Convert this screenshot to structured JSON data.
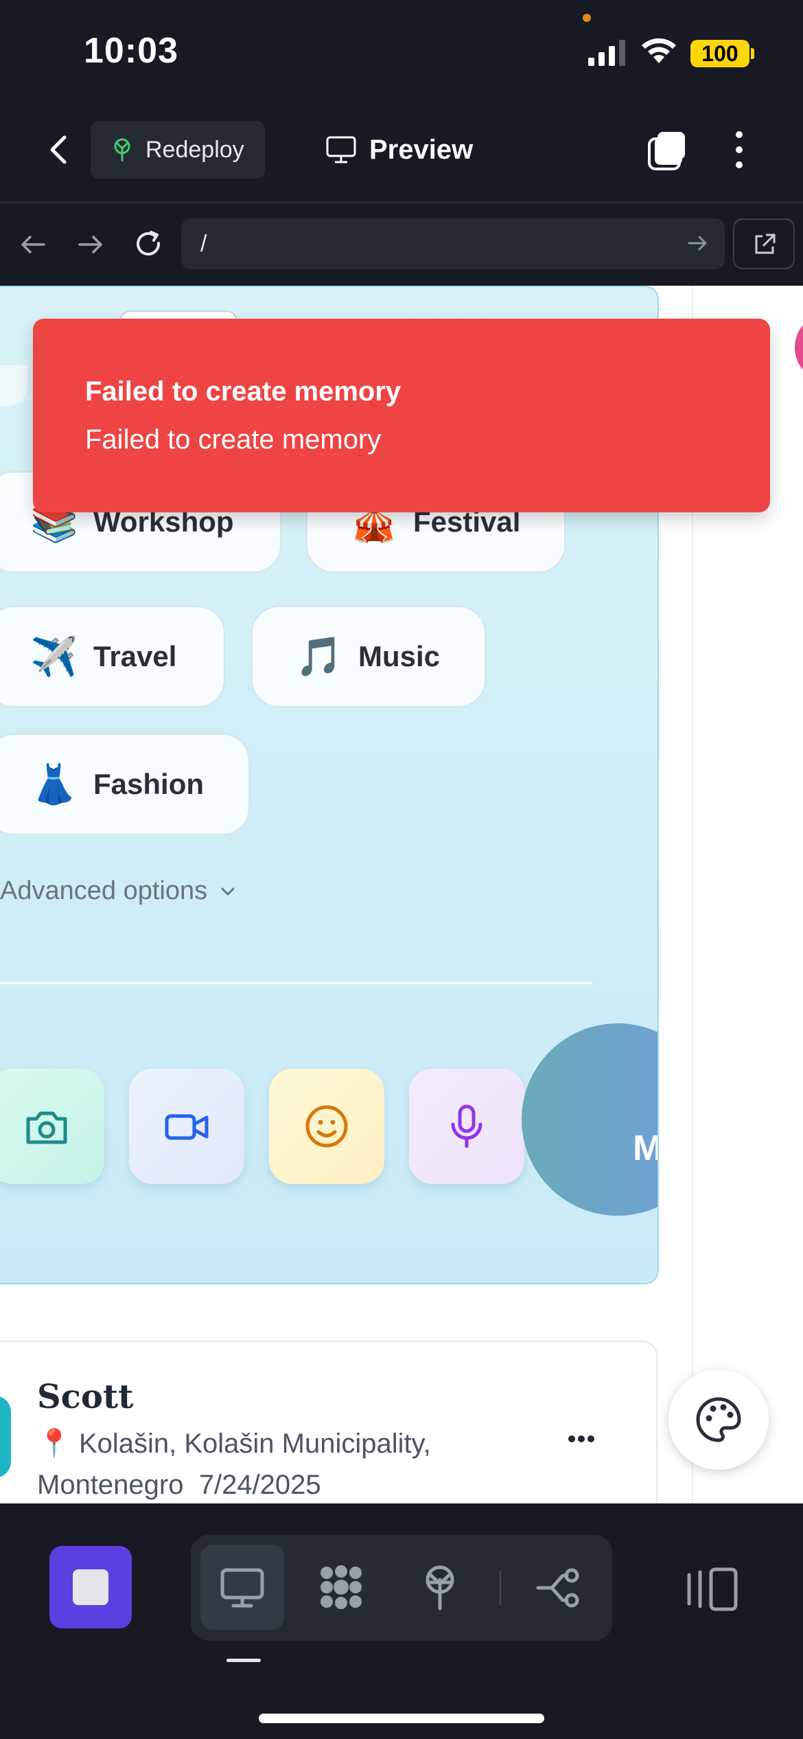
{
  "status_bar": {
    "time": "10:03",
    "battery": "100"
  },
  "top_nav": {
    "redeploy_label": "Redeploy",
    "preview_label": "Preview"
  },
  "url_bar": {
    "url": "/"
  },
  "categories": [
    {
      "emoji": "📚",
      "label": "Workshop"
    },
    {
      "emoji": "🎪",
      "label": "Festival"
    },
    {
      "emoji": "✈️",
      "label": "Travel"
    },
    {
      "emoji": "🎵",
      "label": "Music"
    },
    {
      "emoji": "👗",
      "label": "Fashion"
    }
  ],
  "advanced_options_label": "Advanced options",
  "media_buttons": [
    {
      "name": "camera",
      "color": "#1f8a8a"
    },
    {
      "name": "video",
      "color": "#2563eb"
    },
    {
      "name": "emoji",
      "color": "#d97706"
    },
    {
      "name": "microphone",
      "color": "#9333ea"
    }
  ],
  "big_button_label": "M",
  "post": {
    "author": "Scott",
    "location_icon": "📍",
    "location": "Kolašin, Kolašin Municipality, Montenegro",
    "date": "7/24/2025"
  },
  "toast": {
    "title": "Failed to create memory",
    "message": "Failed to create memory",
    "color": "#ef4444"
  },
  "colors": {
    "stop_button": "#5b3fe0",
    "chrome_bg": "#171a23"
  }
}
